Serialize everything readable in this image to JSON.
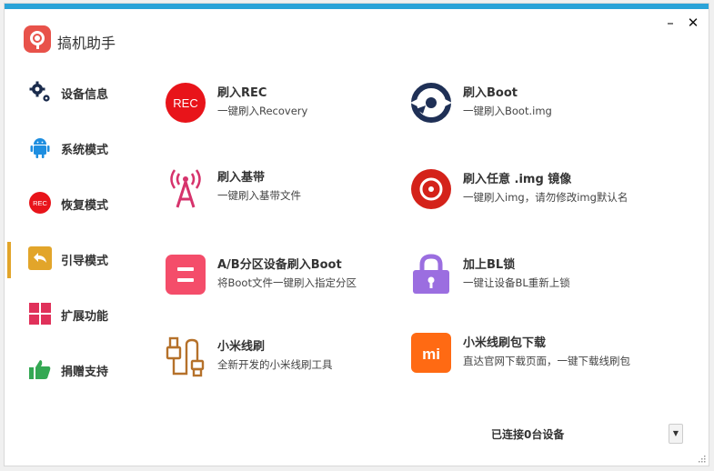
{
  "app": {
    "title": "搞机助手"
  },
  "window_controls": {
    "minimize": "–",
    "close": "✕"
  },
  "colors": {
    "accent_bar": "#2aa3d8",
    "active_indicator": "#e2a52a"
  },
  "sidebar": {
    "active_index": 3,
    "items": [
      {
        "label": "设备信息",
        "icon": "gears-icon"
      },
      {
        "label": "系统模式",
        "icon": "android-icon"
      },
      {
        "label": "恢复模式",
        "icon": "rec-icon",
        "icon_text": "REC"
      },
      {
        "label": "引导模式",
        "icon": "back-arrow-icon"
      },
      {
        "label": "扩展功能",
        "icon": "grid-icon"
      },
      {
        "label": "捐赠支持",
        "icon": "thumbs-up-icon"
      }
    ]
  },
  "actions": [
    {
      "title": "刷入REC",
      "desc": "一键刷入Recovery",
      "icon": "rec-icon",
      "icon_text": "REC"
    },
    {
      "title": "刷入Boot",
      "desc": "一键刷入Boot.img",
      "icon": "boot-disc-icon"
    },
    {
      "title": "刷入基带",
      "desc": "一键刷入基带文件",
      "icon": "antenna-icon"
    },
    {
      "title": "刷入任意 .img 镜像",
      "desc": "一键刷入img，请勿修改img默认名",
      "icon": "disc-icon"
    },
    {
      "title": "A/B分区设备刷入Boot",
      "desc": "将Boot文件一键刷入指定分区",
      "icon": "partition-icon"
    },
    {
      "title": "加上BL锁",
      "desc": "一键让设备BL重新上锁",
      "icon": "lock-icon"
    },
    {
      "title": "小米线刷",
      "desc": "全新开发的小米线刷工具",
      "icon": "usb-cable-icon"
    },
    {
      "title": "小米线刷包下载",
      "desc": "直达官网下载页面，一键下载线刷包",
      "icon": "mi-logo-icon",
      "icon_text": "mi"
    }
  ],
  "status": {
    "text": "已连接0台设备",
    "dropdown_arrow": "▼"
  }
}
